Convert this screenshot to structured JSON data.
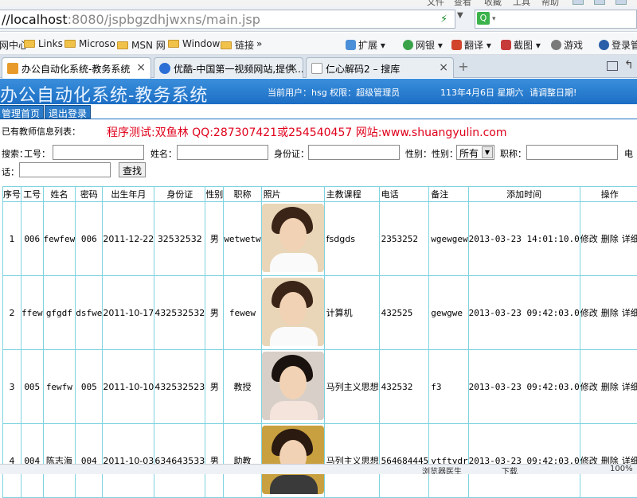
{
  "browser": {
    "menu": [
      "文件",
      "查看",
      "收藏",
      "工具",
      "帮助"
    ],
    "address": {
      "host": "//localhost",
      "rest": ":8080/jspbgzdhjwxns/main.jsp"
    },
    "bookmarks": [
      "网中心",
      "Links",
      "Microso",
      "MSN 网",
      "Window",
      "链接",
      "»"
    ],
    "toolbar": [
      "扩展",
      "网银",
      "翻译",
      "截图",
      "游戏",
      "登录管家"
    ],
    "tabs": [
      {
        "label": "办公自动化系统-教务系统",
        "close": "×"
      },
      {
        "label": "优酷-中国第一视频网站,提供...",
        "close": "×"
      },
      {
        "label": "仁心解码2 – 搜库",
        "close": "×"
      }
    ],
    "new_tab": "+",
    "status": {
      "left": "浏览器医生",
      "download": "下载",
      "zoom": "100%"
    }
  },
  "app": {
    "title": "办公自动化系统-教务系统",
    "current_user": "当前用户：hsg 权限：超级管理员",
    "date": "113年4月6日 星期六",
    "date_tip": "请调整日期!",
    "nav": [
      "管理首页",
      "退出登录"
    ],
    "list_title": "已有教师信息列表：",
    "test_line": "程序测试:双鱼林 QQ:287307421或254540457 网站:www.shuangyulin.com"
  },
  "search": {
    "prefix": "搜索：",
    "job_no": "工号：",
    "name": "姓名：",
    "id_card": "身份证：",
    "gender_label": "性别：性别：",
    "gender_value": "所有",
    "title": "职称：",
    "phone_1": "电",
    "phone_2": "话：",
    "button": "查找"
  },
  "table": {
    "headers": [
      "序号",
      "工号",
      "姓名",
      "密码",
      "出生年月",
      "身份证",
      "性别",
      "职称",
      "照片",
      "主教课程",
      "电话",
      "备注",
      "添加时间",
      "操作"
    ],
    "rows": [
      {
        "no": "1",
        "job": "006",
        "name": "fewfew",
        "pwd": "006",
        "birth": "2011-12-22",
        "id": "32532532",
        "gender": "男",
        "title": "wetwetw",
        "course": "fsdgds",
        "phone": "2353252",
        "note": "wgewgew",
        "added": "2013-03-23 14:01:10.0",
        "photo": "boy"
      },
      {
        "no": "2",
        "job": "ffew",
        "name": "gfgdf",
        "pwd": "dsfwe",
        "birth": "2011-10-17",
        "id": "432532532",
        "gender": "男",
        "title": "fewew",
        "course": "计算机",
        "phone": "432525",
        "note": "gewgwe",
        "added": "2013-03-23 09:42:03.0",
        "photo": "boy"
      },
      {
        "no": "3",
        "job": "005",
        "name": "fewfw",
        "pwd": "005",
        "birth": "2011-10-10",
        "id": "432532523",
        "gender": "男",
        "title": "教授",
        "course": "马列主义思想",
        "phone": "432532",
        "note": "f3",
        "added": "2013-03-23 09:42:03.0",
        "photo": "girl"
      },
      {
        "no": "4",
        "job": "004",
        "name": "陈志海",
        "pwd": "004",
        "birth": "2011-10-03",
        "id": "634643533",
        "gender": "男",
        "title": "助教",
        "course": "马列主义思想",
        "phone": "564684445",
        "note": "ytftydr",
        "added": "2013-03-23 09:42:03.0",
        "photo": "boy2"
      }
    ],
    "actions": [
      "修改",
      "删除",
      "详细"
    ]
  }
}
